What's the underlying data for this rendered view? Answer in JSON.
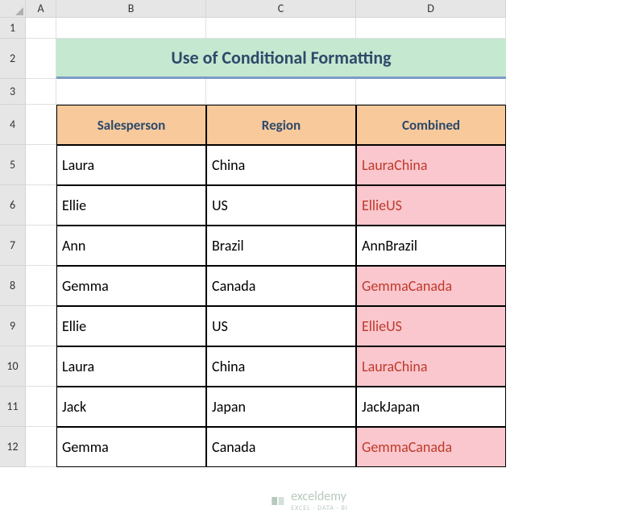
{
  "columns": [
    "A",
    "B",
    "C",
    "D"
  ],
  "row_numbers": [
    "1",
    "2",
    "3",
    "4",
    "5",
    "6",
    "7",
    "8",
    "9",
    "10",
    "11",
    "12"
  ],
  "title": "Use of Conditional Formatting",
  "table_headers": {
    "salesperson": "Salesperson",
    "region": "Region",
    "combined": "Combined"
  },
  "rows": [
    {
      "salesperson": "Laura",
      "region": "China",
      "combined": "LauraChina",
      "highlight": true
    },
    {
      "salesperson": "Ellie",
      "region": "US",
      "combined": "EllieUS",
      "highlight": true
    },
    {
      "salesperson": "Ann",
      "region": "Brazil",
      "combined": "AnnBrazil",
      "highlight": false
    },
    {
      "salesperson": "Gemma",
      "region": "Canada",
      "combined": "GemmaCanada",
      "highlight": true
    },
    {
      "salesperson": "Ellie",
      "region": "US",
      "combined": "EllieUS",
      "highlight": true
    },
    {
      "salesperson": "Laura",
      "region": "China",
      "combined": "LauraChina",
      "highlight": true
    },
    {
      "salesperson": "Jack",
      "region": "Japan",
      "combined": "JackJapan",
      "highlight": false
    },
    {
      "salesperson": "Gemma",
      "region": "Canada",
      "combined": "GemmaCanada",
      "highlight": true
    }
  ],
  "watermark": {
    "text": "exceldemy",
    "subtext": "EXCEL · DATA · BI"
  }
}
